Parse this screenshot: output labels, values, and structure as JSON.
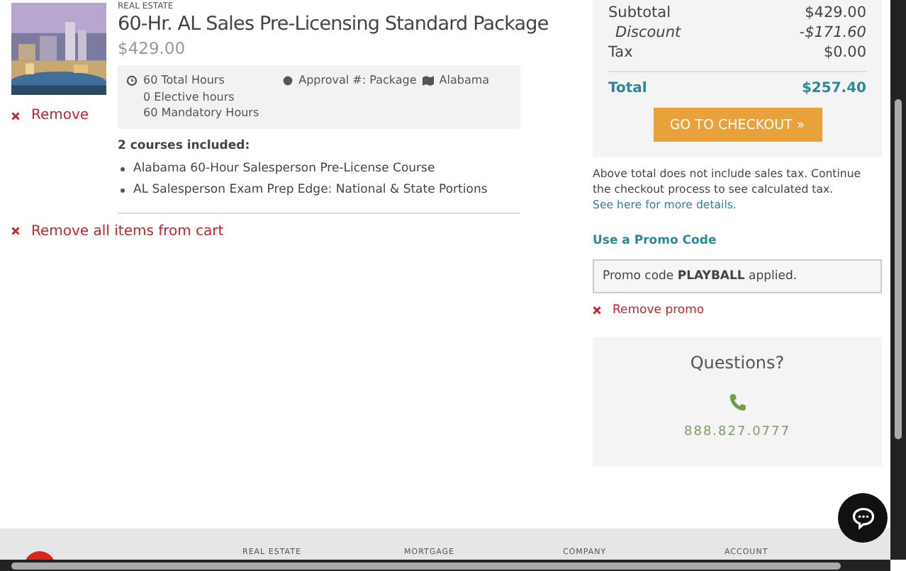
{
  "cart_item": {
    "category": "REAL ESTATE",
    "title": "60-Hr. AL Sales Pre-Licensing Standard Package",
    "price": "$429.00",
    "remove_label": "Remove",
    "details": {
      "hours": [
        "60 Total Hours",
        "0 Elective hours",
        "60 Mandatory Hours"
      ],
      "approval": "Approval #: Package",
      "state": "Alabama"
    },
    "courses_heading": "2 courses included:",
    "courses": [
      "Alabama 60-Hour Salesperson Pre-License Course",
      "AL Salesperson Exam Prep Edge: National & State Portions"
    ]
  },
  "remove_all": "Remove all items from cart",
  "summary": {
    "lines": [
      {
        "label": "Subtotal",
        "value": "$429.00",
        "kind": "plain"
      },
      {
        "label": "Discount",
        "value": "-$171.60",
        "kind": "discount"
      },
      {
        "label": "Tax",
        "value": "$0.00",
        "kind": "plain"
      }
    ],
    "total": {
      "label": "Total",
      "value": "$257.40"
    },
    "checkout_button": "GO TO CHECKOUT »"
  },
  "tax_note": "Above total does not include sales tax. Continue the checkout process to see calculated tax.",
  "tax_link": "See here for more details.",
  "promo": {
    "heading": "Use a Promo Code",
    "message": "Promo code **PLAYBALL** applied.",
    "remove_label": "Remove promo"
  },
  "questions": {
    "heading": "Questions?",
    "phone": "888.827.0777"
  },
  "footer": {
    "headings": [
      "REAL ESTATE",
      "MORTGAGE",
      "COMPANY",
      "ACCOUNT"
    ]
  }
}
